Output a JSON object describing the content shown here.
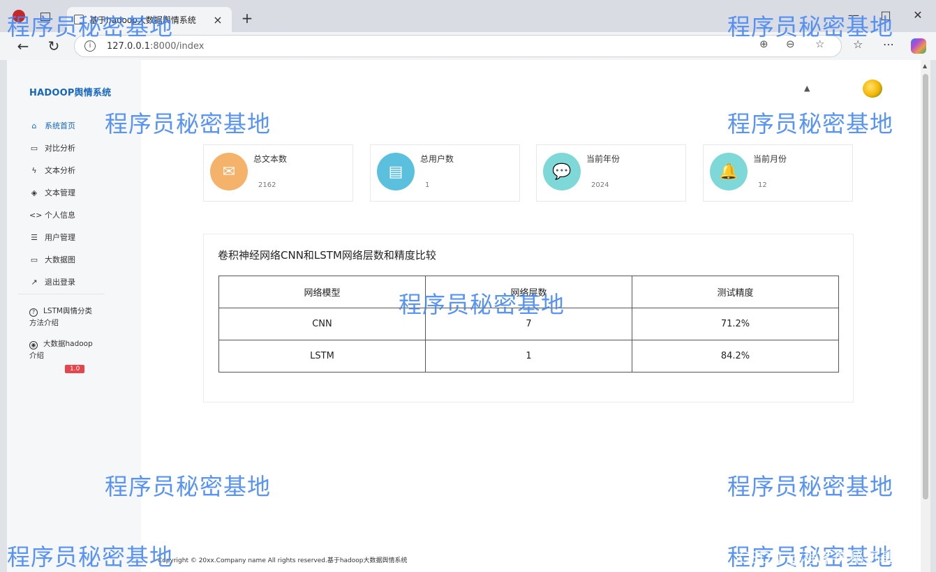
{
  "browser": {
    "tab_title": "基于hadoop大数据舆情系统",
    "new_tab": "+",
    "close": "×",
    "url_host": "127.0.0.1",
    "url_rest": ":8000/index",
    "win_min": "—",
    "win_max": "□",
    "win_close": "✕"
  },
  "sidebar": {
    "brand": "HADOOP舆情系统",
    "items": [
      {
        "label": "系统首页",
        "icon": "home-icon",
        "glyph": "⌂"
      },
      {
        "label": "对比分析",
        "icon": "monitor-icon",
        "glyph": "▭"
      },
      {
        "label": "文本分析",
        "icon": "bolt-icon",
        "glyph": "ϟ"
      },
      {
        "label": "文本管理",
        "icon": "layers-icon",
        "glyph": "◈"
      },
      {
        "label": "个人信息",
        "icon": "code-icon",
        "glyph": "<>"
      },
      {
        "label": "用户管理",
        "icon": "list-icon",
        "glyph": "☰"
      },
      {
        "label": "大数据图",
        "icon": "monitor-icon",
        "glyph": "▭"
      },
      {
        "label": "退出登录",
        "icon": "trend-icon",
        "glyph": "↗"
      }
    ],
    "help1": "LSTM舆情分类方法介绍",
    "help2": "大数据hadoop介绍",
    "version": "1.0"
  },
  "stats": [
    {
      "label": "总文本数",
      "value": "2162",
      "color": "#f5b26b",
      "icon": "mail-icon",
      "glyph": "✉"
    },
    {
      "label": "总用户数",
      "value": "1",
      "color": "#5bc0de",
      "icon": "document-icon",
      "glyph": "▤"
    },
    {
      "label": "当前年份",
      "value": "2024",
      "color": "#7fd8d8",
      "icon": "chat-icon",
      "glyph": "💬"
    },
    {
      "label": "当前月份",
      "value": "12",
      "color": "#7fd8d8",
      "icon": "bell-icon",
      "glyph": "🔔"
    }
  ],
  "panel": {
    "title": "卷积神经网络CNN和LSTM网络层数和精度比较",
    "headers": [
      "网络模型",
      "网络层数",
      "测试精度"
    ],
    "rows": [
      [
        "CNN",
        "7",
        "71.2%"
      ],
      [
        "LSTM",
        "1",
        "84.2%"
      ]
    ]
  },
  "footer": "Copyright © 20xx.Company name All rights reserved.基于hadoop大数据舆情系统",
  "watermark": "程序员秘密基地",
  "watermark_csdn": "CSDN @程序员秘密基地"
}
